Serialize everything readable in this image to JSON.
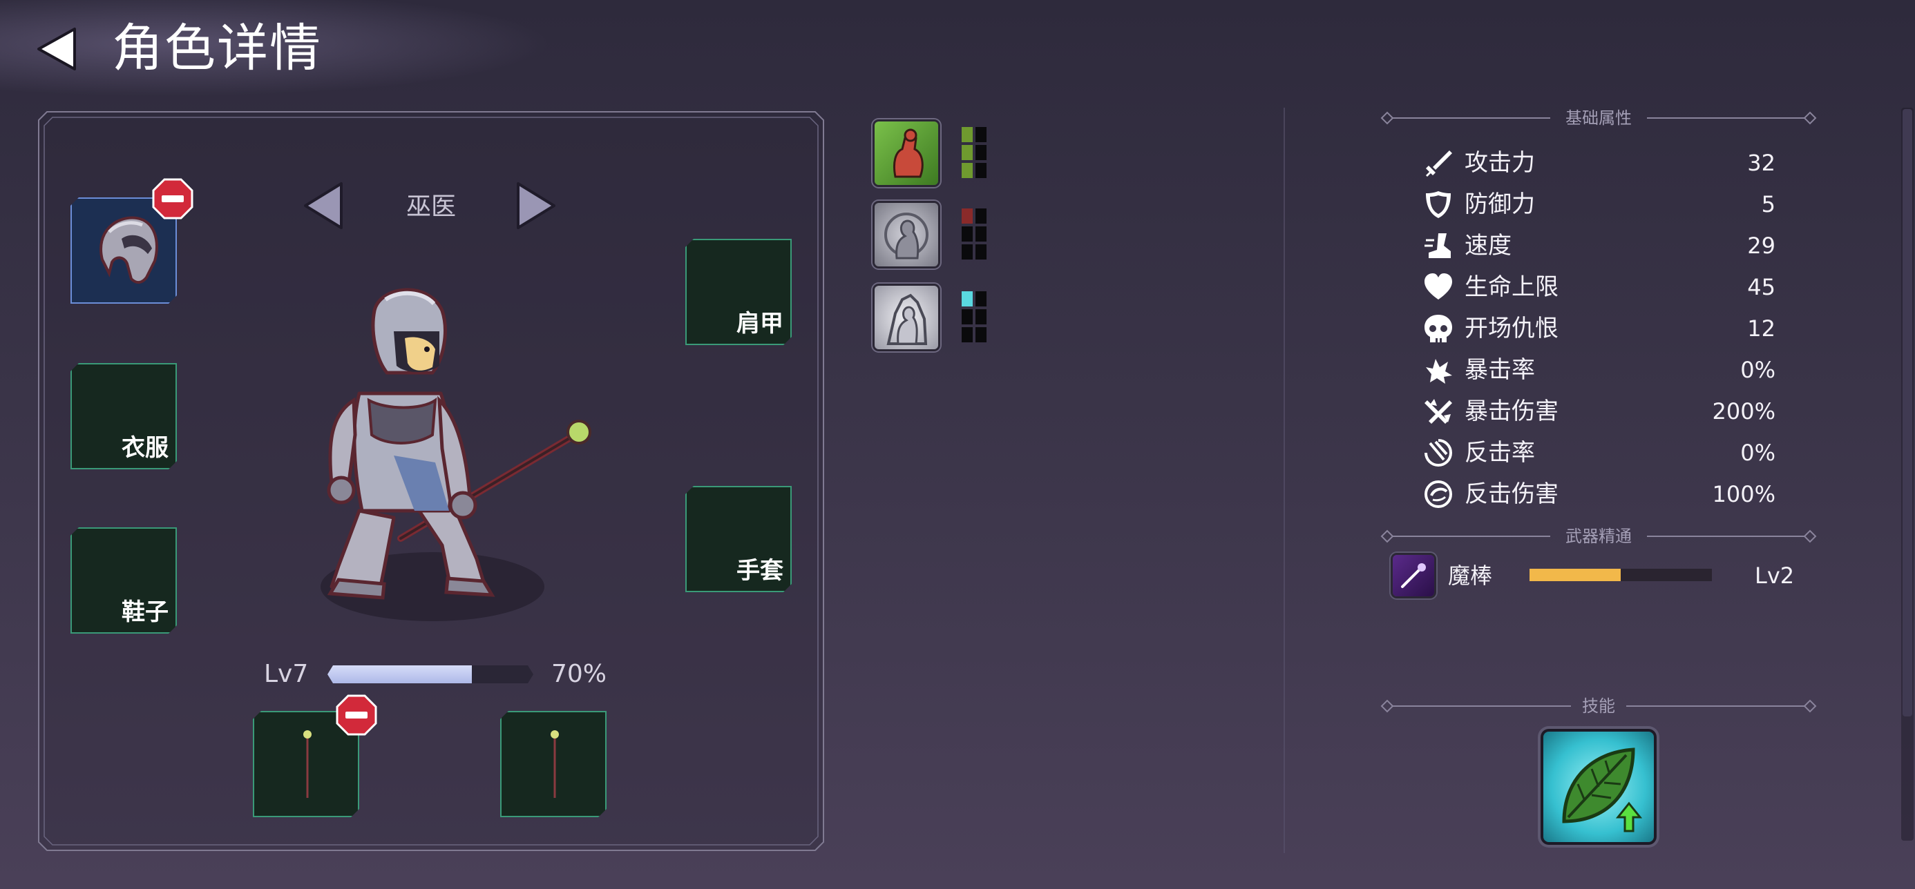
{
  "header": {
    "title": "角色详情",
    "back_icon": "back-arrow-icon"
  },
  "character": {
    "name": "巫医",
    "level_label": "Lv7",
    "xp_percent_label": "70%",
    "xp_fraction": 0.7
  },
  "equipment": {
    "helmet": {
      "label": "",
      "equipped": true,
      "removable": true
    },
    "clothes": {
      "label": "衣服"
    },
    "shoes": {
      "label": "鞋子"
    },
    "shoulder": {
      "label": "肩甲"
    },
    "gloves": {
      "label": "手套"
    },
    "weapon_main": {
      "equipped": true,
      "removable": true
    },
    "weapon_off": {
      "equipped": true
    }
  },
  "status_effects": [
    {
      "icon": "strength-icon",
      "color": "#6f9a2f",
      "pips": 6,
      "filled": 3
    },
    {
      "icon": "target-silhouette-icon",
      "color": "#8a2a2a",
      "pips": 6,
      "filled": 1
    },
    {
      "icon": "spirit-silhouette-icon",
      "color": "#5ad8e0",
      "pips": 6,
      "filled": 1
    }
  ],
  "sections": {
    "base_stats_title": "基础属性",
    "weapon_mastery_title": "武器精通",
    "skills_title": "技能"
  },
  "stats": [
    {
      "icon": "sword-icon",
      "label": "攻击力",
      "value": "32"
    },
    {
      "icon": "shield-icon",
      "label": "防御力",
      "value": "5"
    },
    {
      "icon": "boot-speed-icon",
      "label": "速度",
      "value": "29"
    },
    {
      "icon": "heart-icon",
      "label": "生命上限",
      "value": "45"
    },
    {
      "icon": "skull-icon",
      "label": "开场仇恨",
      "value": "12"
    },
    {
      "icon": "crit-burst-icon",
      "label": "暴击率",
      "value": "0%"
    },
    {
      "icon": "crossed-swords-icon",
      "label": "暴击伤害",
      "value": "200%"
    },
    {
      "icon": "counter-icon",
      "label": "反击率",
      "value": "0%"
    },
    {
      "icon": "counter-damage-icon",
      "label": "反击伤害",
      "value": "100%"
    }
  ],
  "weapon_mastery": {
    "name": "魔棒",
    "level_label": "Lv2",
    "progress_fraction": 0.5,
    "icon": "magic-wand-icon"
  },
  "skills": [
    {
      "icon": "leaf-upgrade-icon"
    }
  ],
  "colors": {
    "background": "#3a3448",
    "slot_bg": "#16281f",
    "slot_border": "#3a9a78",
    "mastery_bar": "#f2b84a",
    "xp_bar": "#c8d0f2",
    "remove_badge": "#d2293a"
  }
}
